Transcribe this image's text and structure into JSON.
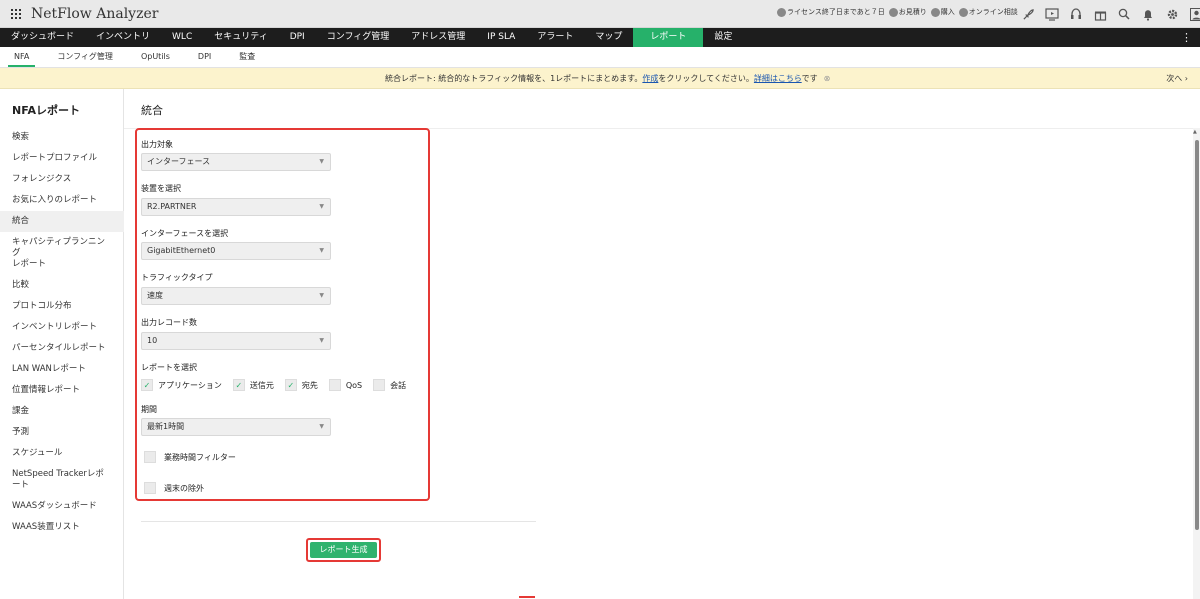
{
  "header": {
    "app_title": "NetFlow Analyzer",
    "links": [
      "ライセンス終了日まであと７日",
      "お見積り",
      "購入",
      "オンライン相談"
    ]
  },
  "nav": {
    "items": [
      "ダッシュボード",
      "インベントリ",
      "WLC",
      "セキュリティ",
      "DPI",
      "コンフィグ管理",
      "アドレス管理",
      "IP SLA",
      "アラート",
      "マップ",
      "レポート",
      "設定"
    ],
    "active_index": 10
  },
  "subnav": {
    "items": [
      "NFA",
      "コンフィグ管理",
      "OpUtils",
      "DPI",
      "監査"
    ],
    "active_index": 0
  },
  "banner": {
    "text_before": "統合レポート: 統合的なトラフィック情報を、1レポートにまとめます。",
    "link1": "作成",
    "text_middle": "をクリックしてください。",
    "link2": "詳細はこちら",
    "text_after": "です",
    "next": "次へ"
  },
  "sidebar": {
    "title": "NFAレポート",
    "items": [
      "検索",
      "レポートプロファイル",
      "フォレンジクス",
      "お気に入りのレポート",
      "統合",
      "キャパシティプランニング\nレポート",
      "比較",
      "プロトコル分布",
      "インベントリレポート",
      "パーセンタイルレポート",
      "LAN WANレポート",
      "位置情報レポート",
      "課金",
      "予測",
      "スケジュール",
      "NetSpeed Trackerレポート",
      "WAASダッシュボード",
      "WAAS装置リスト"
    ],
    "active_index": 4
  },
  "main": {
    "title": "統合",
    "output_target_label": "出力対象",
    "output_target_value": "インターフェース",
    "device_label": "装置を選択",
    "device_value": "R2.PARTNER",
    "interface_label": "インターフェースを選択",
    "interface_value": "GigabitEthernet0",
    "traffic_type_label": "トラフィックタイプ",
    "traffic_type_value": "速度",
    "record_count_label": "出力レコード数",
    "record_count_value": "10",
    "report_select_label": "レポートを選択",
    "report_options": [
      {
        "label": "アプリケーション",
        "checked": true
      },
      {
        "label": "送信元",
        "checked": true
      },
      {
        "label": "宛先",
        "checked": true
      },
      {
        "label": "QoS",
        "checked": false
      },
      {
        "label": "会話",
        "checked": false
      }
    ],
    "period_label": "期間",
    "period_value": "最新1時間",
    "business_hours_label": "業務時間フィルター",
    "weekend_label": "週末の除外",
    "generate_button": "レポート生成"
  },
  "colors": {
    "accent": "#26b16a",
    "highlight": "#e53935",
    "banner_bg": "#fcf3cd",
    "nav_bg": "#1d1d1d"
  }
}
